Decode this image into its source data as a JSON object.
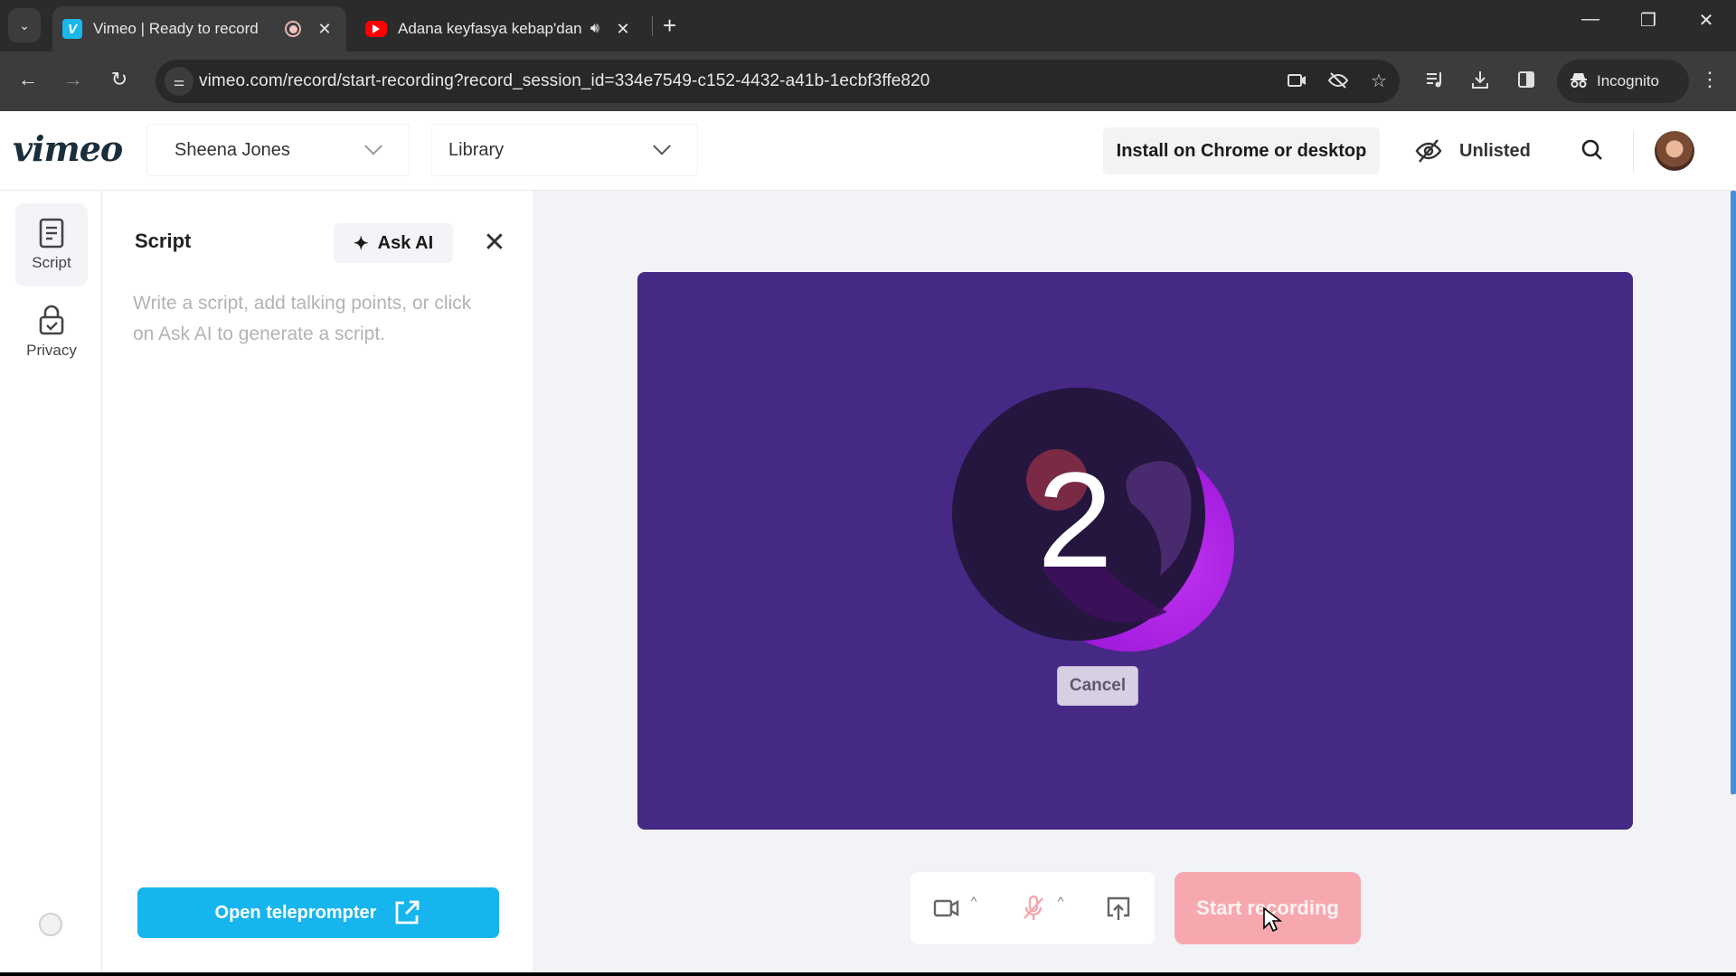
{
  "browser": {
    "tabs": [
      {
        "title": "Vimeo | Ready to record",
        "favicon": "vimeo-icon",
        "recording": true,
        "active": true
      },
      {
        "title": "Adana keyfasya kebap'dan",
        "favicon": "youtube-icon",
        "audio": true,
        "active": false
      }
    ],
    "new_tab_label": "+",
    "url": "vimeo.com/record/start-recording?record_session_id=334e7549-c152-4432-a41b-1ecbf3ffe820",
    "incognito_label": "Incognito",
    "window_controls": {
      "minimize": "—",
      "restore": "❐",
      "close": "✕"
    }
  },
  "header": {
    "logo": "vimeo",
    "account_select": "Sheena Jones",
    "folder_select": "Library",
    "install_button": "Install on Chrome or desktop",
    "privacy_status": "Unlisted"
  },
  "rail": {
    "items": [
      {
        "label": "Script",
        "icon": "document-icon",
        "active": true
      },
      {
        "label": "Privacy",
        "icon": "lock-check-icon",
        "active": false
      }
    ]
  },
  "script_panel": {
    "title": "Script",
    "ask_ai_label": "Ask AI",
    "placeholder": "Write a script, add talking points, or click on Ask AI to generate a script.",
    "value": "",
    "teleprompter_button": "Open teleprompter"
  },
  "stage": {
    "countdown_value": "2",
    "cancel_label": "Cancel",
    "start_recording_label": "Start recording",
    "colors": {
      "preview_bg": "#462985",
      "start_button": "#f7a8ae",
      "teleprompter_button": "#17b5ee"
    }
  }
}
